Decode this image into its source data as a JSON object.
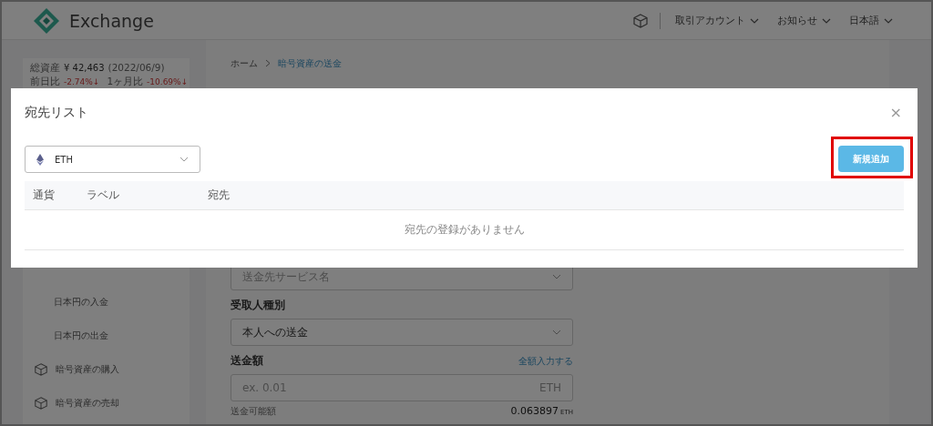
{
  "header": {
    "logo_text": "Exchange",
    "menus": [
      {
        "label": "取引アカウント"
      },
      {
        "label": "お知らせ"
      },
      {
        "label": "日本語"
      }
    ]
  },
  "sidebar": {
    "summary": {
      "total_label": "総資産",
      "total_value": "¥ 42,463",
      "date": "(2022/06/9)",
      "day_label": "前日比",
      "day_change": "-2.74%↓",
      "month_label": "1ヶ月比",
      "month_change": "-10.69%↓"
    },
    "items": [
      {
        "label": "日本円の入金",
        "kind": "sub"
      },
      {
        "label": "日本円の出金",
        "kind": "sub"
      },
      {
        "label": "暗号資産の購入",
        "kind": "cube"
      },
      {
        "label": "暗号資産の売却",
        "kind": "cube"
      }
    ]
  },
  "breadcrumb": [
    {
      "label": "ホーム"
    },
    {
      "label": "暗号資産の送金"
    }
  ],
  "form": {
    "service_select": {
      "placeholder": "送金先サービス名"
    },
    "recipient_label": "受取人種別",
    "recipient_select": {
      "value": "本人への送金"
    },
    "amount_label": "送金額",
    "amount_link": "全額入力する",
    "amount_input": {
      "placeholder": "ex. 0.01",
      "unit": "ETH"
    },
    "available_label": "送金可能額",
    "available_value": "0.063897",
    "available_unit": "ETH"
  },
  "modal": {
    "title": "宛先リスト",
    "close": "×",
    "currency_select": {
      "value": "ETH"
    },
    "add_button": "新規追加",
    "table": {
      "columns": [
        "通貨",
        "ラベル",
        "宛先"
      ],
      "empty_message": "宛先の登録がありません"
    }
  }
}
